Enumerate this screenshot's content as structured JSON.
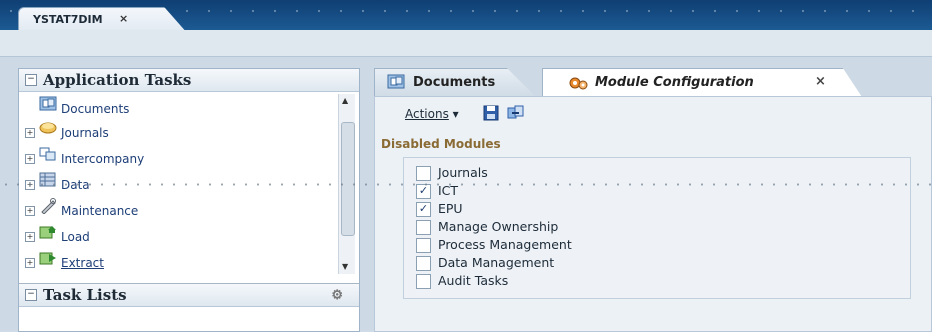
{
  "window": {
    "doc_tab_label": "YSTAT7DIM",
    "doc_tab_close": "×"
  },
  "left_panel": {
    "title": "Application Tasks",
    "items": [
      {
        "label": "Documents",
        "expandable": false,
        "icon": "documents-icon"
      },
      {
        "label": "Journals",
        "expandable": true,
        "icon": "journals-icon"
      },
      {
        "label": "Intercompany",
        "expandable": true,
        "icon": "intercompany-icon"
      },
      {
        "label": "Data",
        "expandable": true,
        "icon": "data-icon"
      },
      {
        "label": "Maintenance",
        "expandable": true,
        "icon": "maintenance-icon"
      },
      {
        "label": "Load",
        "expandable": true,
        "icon": "load-icon"
      },
      {
        "label": "Extract",
        "expandable": true,
        "icon": "extract-icon"
      }
    ],
    "task_lists_title": "Task Lists"
  },
  "tabs": {
    "documents": "Documents",
    "module_config": "Module Configuration",
    "close": "×"
  },
  "toolbar": {
    "actions_label": "Actions"
  },
  "disabled_modules": {
    "label": "Disabled Modules",
    "items": [
      {
        "label": "Journals",
        "checked": false
      },
      {
        "label": "ICT",
        "checked": true
      },
      {
        "label": "EPU",
        "checked": true
      },
      {
        "label": "Manage Ownership",
        "checked": false
      },
      {
        "label": "Process Management",
        "checked": false
      },
      {
        "label": "Data Management",
        "checked": false
      },
      {
        "label": "Audit Tasks",
        "checked": false
      }
    ]
  }
}
